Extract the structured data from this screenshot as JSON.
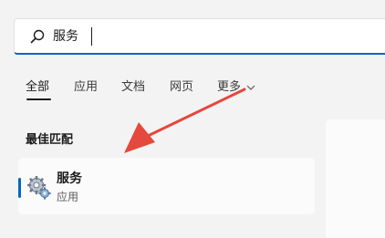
{
  "search": {
    "query": "服务"
  },
  "tabs": [
    {
      "label": "全部"
    },
    {
      "label": "应用"
    },
    {
      "label": "文档"
    },
    {
      "label": "网页"
    },
    {
      "label": "更多"
    }
  ],
  "best_match": {
    "title": "最佳匹配",
    "result": {
      "name": "服务",
      "type": "应用"
    }
  },
  "icons": {
    "search": "search-icon",
    "more": "chevron-down-icon",
    "app": "services-gear-icon"
  },
  "colors": {
    "accent": "#0067c0",
    "annotation": "#e5483c",
    "background": "#f3f3f3"
  }
}
